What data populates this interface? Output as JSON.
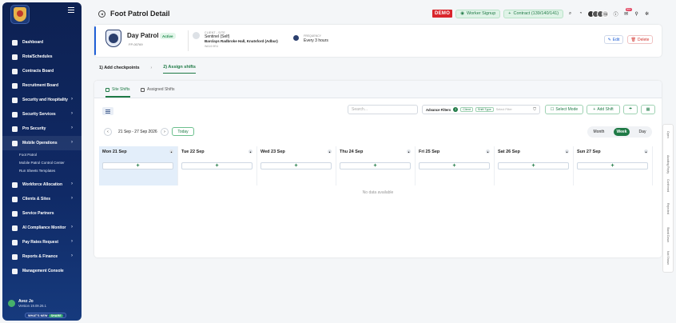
{
  "sidebar": {
    "items": [
      {
        "label": "Dashboard",
        "chevron": false
      },
      {
        "label": "Rota/Schedules",
        "chevron": false
      },
      {
        "label": "Contracts Board",
        "chevron": false
      },
      {
        "label": "Recruitment Board",
        "chevron": false
      },
      {
        "label": "Security and Hospitality",
        "chevron": true
      },
      {
        "label": "Security Services",
        "chevron": true
      },
      {
        "label": "Pro Security",
        "chevron": true
      },
      {
        "label": "Mobile Operations",
        "chevron": true
      }
    ],
    "subitems": [
      "Foot Patrol",
      "Mobile Patrol Control Center",
      "Run Sheets Templates"
    ],
    "items_after": [
      {
        "label": "Workforce Allocation",
        "chevron": true
      },
      {
        "label": "Clients & Sites",
        "chevron": true
      },
      {
        "label": "Service Partners",
        "chevron": false
      },
      {
        "label": "AI Compliance Monitor",
        "chevron": true
      },
      {
        "label": "Pay Rates Request",
        "chevron": true
      },
      {
        "label": "Reports & Finance",
        "chevron": true
      },
      {
        "label": "Management Console",
        "chevron": false
      }
    ],
    "user": {
      "name": "Avez Jo",
      "version": "Version 19.09.26.1"
    },
    "whats_new": {
      "label": "WHAT'S NEW",
      "badge": "SHARE"
    }
  },
  "header": {
    "title": "Foot Patrol Detail",
    "demo": "DEMO",
    "worker_signup": "Worker Signup",
    "contract": "Contract (139/140/141)",
    "avatar_more": "+6",
    "notif_count": "99+"
  },
  "patrol": {
    "title": "Day Patrol",
    "status": "Active",
    "code": "FP-00769",
    "client_label": "CLIENT - SITE",
    "client_name": "Sentinel (Self)",
    "client_address": "Barclays Radbroke Hall, Knutsford (Adbur)",
    "client_sub": "WA16 9EU",
    "freq_label": "FREQUENCY",
    "freq_value": "Every 3 hours",
    "edit": "Edit",
    "delete": "Delete"
  },
  "steps": [
    "1) Add checkpoints",
    "2) Assign shifts"
  ],
  "panel": {
    "tabs": [
      "Site Shifts",
      "Assigned Shifts"
    ],
    "search_placeholder": "Search...",
    "filters_label": "Advance Filters",
    "filters_count": "2",
    "filter_chips": [
      "Client",
      "Shift Type"
    ],
    "filter_more": "Select Filter",
    "select_mode": "Select Mode",
    "add_shift": "Add Shift",
    "date_range": "21 Sep - 27 Sep 2026",
    "today": "Today",
    "views": [
      "Month",
      "Week",
      "Day"
    ],
    "days": [
      "Mon 21 Sep",
      "Tue 22 Sep",
      "Wed 23 Sep",
      "Thu 24 Sep",
      "Fri 25 Sep",
      "Sat 26 Sep",
      "Sun 27 Sep"
    ],
    "add_symbol": "+",
    "no_data": "No data available"
  },
  "rail": [
    "Open",
    "Awaiting Reply",
    "Confirmed",
    "Rejected",
    "Stand Down",
    "Not Shown"
  ]
}
